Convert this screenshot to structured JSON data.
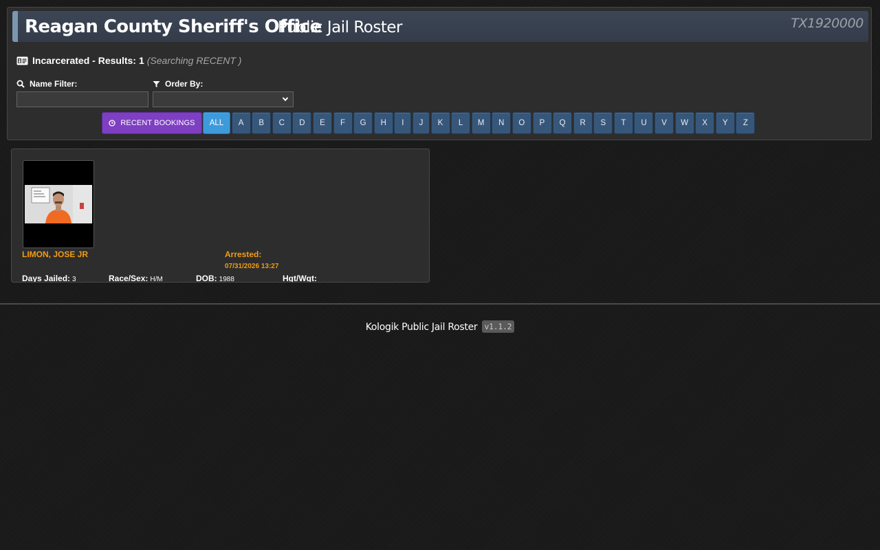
{
  "header": {
    "agency_name": "Reagan County Sheriff's Office",
    "roster_title": "Public Jail Roster",
    "ori_code": "TX1920000"
  },
  "results": {
    "label": "Incarcerated - Results:",
    "count": "1",
    "searching": "(Searching RECENT )"
  },
  "filters": {
    "name_filter_label": "Name Filter:",
    "name_filter_value": "",
    "order_by_label": "Order By:",
    "order_by_value": ""
  },
  "letter_bar": {
    "recent_label": "RECENT BOOKINGS",
    "buttons": [
      "ALL",
      "A",
      "B",
      "C",
      "D",
      "E",
      "F",
      "G",
      "H",
      "I",
      "J",
      "K",
      "L",
      "M",
      "N",
      "O",
      "P",
      "Q",
      "R",
      "S",
      "T",
      "U",
      "V",
      "W",
      "X",
      "Y",
      "Z"
    ],
    "active": "ALL"
  },
  "inmates": [
    {
      "name": "LIMON, JOSE JR",
      "arrested_label": "Arrested:",
      "arrested_date": "07/31/2026 13:27",
      "days_jailed_label": "Days Jailed:",
      "days_jailed": "3",
      "race_sex_label": "Race/Sex:",
      "race_sex": "H/M",
      "dob_label": "DOB:",
      "dob": "1988",
      "hgt_wgt_label": "Hgt/Wgt:",
      "hgt_wgt": ""
    }
  ],
  "footer": {
    "text": "Kologik Public Jail Roster",
    "version": "v1.1.2"
  },
  "colors": {
    "accent_orange": "#f39c12",
    "recent_purple": "#7e3fc2",
    "letter_blue": "#37577a",
    "active_blue": "#3d9bdc"
  }
}
